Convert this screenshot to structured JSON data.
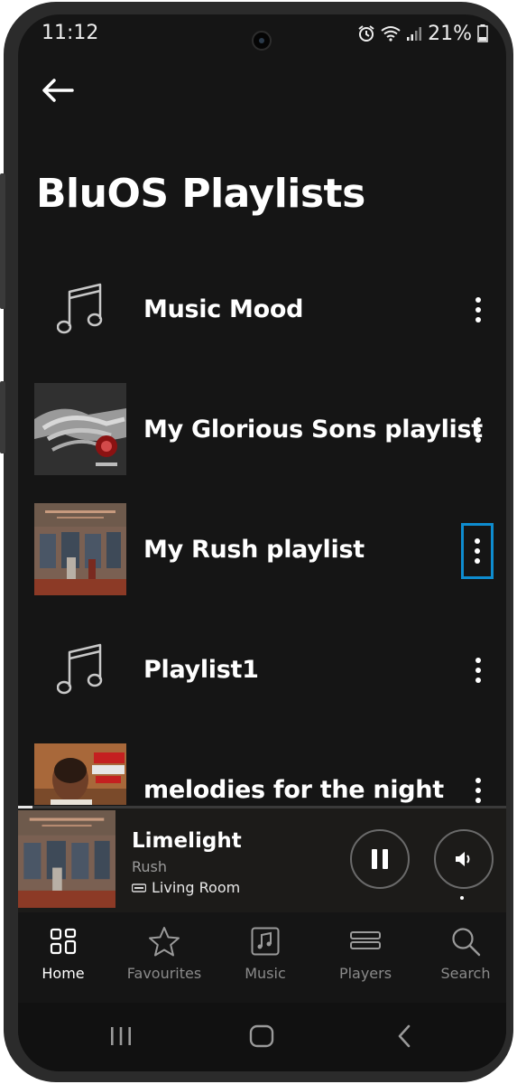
{
  "status_bar": {
    "time": "11:12",
    "battery": "21%"
  },
  "page": {
    "title": "BluOS Playlists"
  },
  "playlists": [
    {
      "name": "Music Mood",
      "thumb": "music-note-icon"
    },
    {
      "name": "My Glorious Sons playlist",
      "thumb": "album-art"
    },
    {
      "name": "My Rush playlist",
      "thumb": "album-art"
    },
    {
      "name": "Playlist1",
      "thumb": "music-note-icon"
    },
    {
      "name": "melodies for the night",
      "thumb": "album-art"
    }
  ],
  "now_playing": {
    "title": "Limelight",
    "artist": "Rush",
    "zone": "Living Room",
    "progress": 0.03,
    "state": "playing"
  },
  "nav": [
    {
      "label": "Home",
      "icon": "home-grid-icon",
      "active": true
    },
    {
      "label": "Favourites",
      "icon": "star-icon",
      "active": false
    },
    {
      "label": "Music",
      "icon": "music-icon",
      "active": false
    },
    {
      "label": "Players",
      "icon": "players-icon",
      "active": false
    },
    {
      "label": "Search",
      "icon": "search-icon",
      "active": false
    }
  ],
  "colors": {
    "background": "#151515",
    "accent_focus": "#0e8ccf",
    "text": "#ffffff",
    "muted": "#8a8a8a"
  }
}
